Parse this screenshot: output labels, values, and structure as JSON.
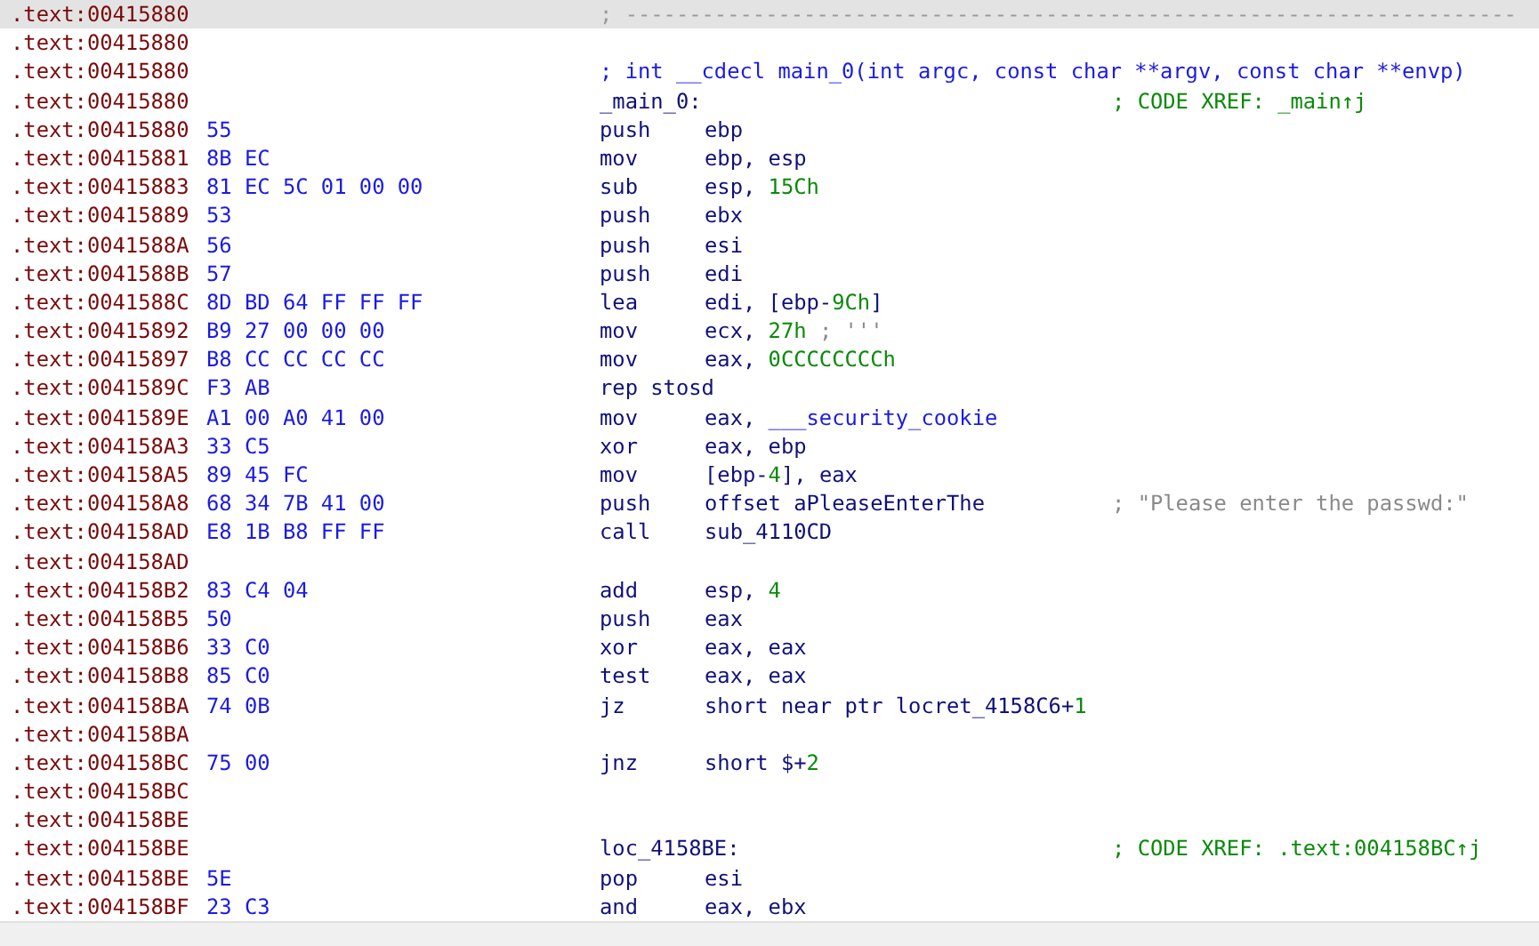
{
  "rows": [
    {
      "address": ".text:00415880",
      "selected": true,
      "line": {
        "text": "; ----------------------------------------------------------------------",
        "kind": "separator"
      }
    },
    {
      "address": ".text:00415880",
      "selected": false
    },
    {
      "address": ".text:00415880",
      "selected": false,
      "line": {
        "text": "; int __cdecl main_0(int argc, const char **argv, const char **envp)",
        "kind": "declaration"
      }
    },
    {
      "address": ".text:00415880",
      "selected": false,
      "line": {
        "text": "_main_0:",
        "kind": "label"
      },
      "comment": {
        "text": "; CODE XREF: _main↑j",
        "kind": "xref"
      }
    },
    {
      "address": ".text:00415880",
      "bytes": "55",
      "selected": false,
      "mnemonic": "push",
      "operands": [
        {
          "text": "ebp",
          "kind": "plain"
        }
      ]
    },
    {
      "address": ".text:00415881",
      "bytes": "8B EC",
      "selected": false,
      "mnemonic": "mov",
      "operands": [
        {
          "text": "ebp, esp",
          "kind": "plain"
        }
      ]
    },
    {
      "address": ".text:00415883",
      "bytes": "81 EC 5C 01 00 00",
      "selected": false,
      "mnemonic": "sub",
      "operands": [
        {
          "text": "esp, ",
          "kind": "plain"
        },
        {
          "text": "15Ch",
          "kind": "number"
        }
      ]
    },
    {
      "address": ".text:00415889",
      "bytes": "53",
      "selected": false,
      "mnemonic": "push",
      "operands": [
        {
          "text": "ebx",
          "kind": "plain"
        }
      ]
    },
    {
      "address": ".text:0041588A",
      "bytes": "56",
      "selected": false,
      "mnemonic": "push",
      "operands": [
        {
          "text": "esi",
          "kind": "plain"
        }
      ]
    },
    {
      "address": ".text:0041588B",
      "bytes": "57",
      "selected": false,
      "mnemonic": "push",
      "operands": [
        {
          "text": "edi",
          "kind": "plain"
        }
      ]
    },
    {
      "address": ".text:0041588C",
      "bytes": "8D BD 64 FF FF FF",
      "selected": false,
      "mnemonic": "lea",
      "operands": [
        {
          "text": "edi, [ebp-",
          "kind": "plain"
        },
        {
          "text": "9Ch",
          "kind": "number"
        },
        {
          "text": "]",
          "kind": "plain"
        }
      ]
    },
    {
      "address": ".text:00415892",
      "bytes": "B9 27 00 00 00",
      "selected": false,
      "mnemonic": "mov",
      "operands": [
        {
          "text": "ecx, ",
          "kind": "plain"
        },
        {
          "text": "27h",
          "kind": "number"
        },
        {
          "text": " ; '''",
          "kind": "comment"
        }
      ]
    },
    {
      "address": ".text:00415897",
      "bytes": "B8 CC CC CC CC",
      "selected": false,
      "mnemonic": "mov",
      "operands": [
        {
          "text": "eax, ",
          "kind": "plain"
        },
        {
          "text": "0CCCCCCCCh",
          "kind": "number"
        }
      ]
    },
    {
      "address": ".text:0041589C",
      "bytes": "F3 AB",
      "selected": false,
      "mnemonic": "rep stosd"
    },
    {
      "address": ".text:0041589E",
      "bytes": "A1 00 A0 41 00",
      "selected": false,
      "mnemonic": "mov",
      "operands": [
        {
          "text": "eax, ",
          "kind": "plain"
        },
        {
          "text": "___security_cookie",
          "kind": "symbol"
        }
      ]
    },
    {
      "address": ".text:004158A3",
      "bytes": "33 C5",
      "selected": false,
      "mnemonic": "xor",
      "operands": [
        {
          "text": "eax, ebp",
          "kind": "plain"
        }
      ]
    },
    {
      "address": ".text:004158A5",
      "bytes": "89 45 FC",
      "selected": false,
      "mnemonic": "mov",
      "operands": [
        {
          "text": "[ebp-",
          "kind": "plain"
        },
        {
          "text": "4",
          "kind": "number"
        },
        {
          "text": "], eax",
          "kind": "plain"
        }
      ]
    },
    {
      "address": ".text:004158A8",
      "bytes": "68 34 7B 41 00",
      "selected": false,
      "mnemonic": "push",
      "operands": [
        {
          "text": "offset aPleaseEnterThe",
          "kind": "plain"
        }
      ],
      "comment": {
        "text": "; \"Please enter the passwd:\"",
        "kind": "string"
      }
    },
    {
      "address": ".text:004158AD",
      "bytes": "E8 1B B8 FF FF",
      "selected": false,
      "mnemonic": "call",
      "operands": [
        {
          "text": "sub_4110CD",
          "kind": "plain"
        }
      ]
    },
    {
      "address": ".text:004158AD",
      "selected": false
    },
    {
      "address": ".text:004158B2",
      "bytes": "83 C4 04",
      "selected": false,
      "mnemonic": "add",
      "operands": [
        {
          "text": "esp, ",
          "kind": "plain"
        },
        {
          "text": "4",
          "kind": "number"
        }
      ]
    },
    {
      "address": ".text:004158B5",
      "bytes": "50",
      "selected": false,
      "mnemonic": "push",
      "operands": [
        {
          "text": "eax",
          "kind": "plain"
        }
      ]
    },
    {
      "address": ".text:004158B6",
      "bytes": "33 C0",
      "selected": false,
      "mnemonic": "xor",
      "operands": [
        {
          "text": "eax, eax",
          "kind": "plain"
        }
      ]
    },
    {
      "address": ".text:004158B8",
      "bytes": "85 C0",
      "selected": false,
      "mnemonic": "test",
      "operands": [
        {
          "text": "eax, eax",
          "kind": "plain"
        }
      ]
    },
    {
      "address": ".text:004158BA",
      "bytes": "74 0B",
      "selected": false,
      "mnemonic": "jz",
      "operands": [
        {
          "text": "short near ptr locret_4158C6+",
          "kind": "plain"
        },
        {
          "text": "1",
          "kind": "number"
        }
      ]
    },
    {
      "address": ".text:004158BA",
      "selected": false
    },
    {
      "address": ".text:004158BC",
      "bytes": "75 00",
      "selected": false,
      "mnemonic": "jnz",
      "operands": [
        {
          "text": "short $+",
          "kind": "plain"
        },
        {
          "text": "2",
          "kind": "number"
        }
      ]
    },
    {
      "address": ".text:004158BC",
      "selected": false
    },
    {
      "address": ".text:004158BE",
      "selected": false
    },
    {
      "address": ".text:004158BE",
      "selected": false,
      "line": {
        "text": "loc_4158BE:",
        "kind": "label"
      },
      "comment": {
        "text": "; CODE XREF: .text:004158BC↑j",
        "kind": "xref"
      }
    },
    {
      "address": ".text:004158BE",
      "bytes": "5E",
      "selected": false,
      "mnemonic": "pop",
      "operands": [
        {
          "text": "esi",
          "kind": "plain"
        }
      ]
    },
    {
      "address": ".text:004158BF",
      "bytes": "23 C3",
      "selected": false,
      "mnemonic": "and",
      "operands": [
        {
          "text": "eax, ebx",
          "kind": "plain"
        }
      ]
    }
  ]
}
